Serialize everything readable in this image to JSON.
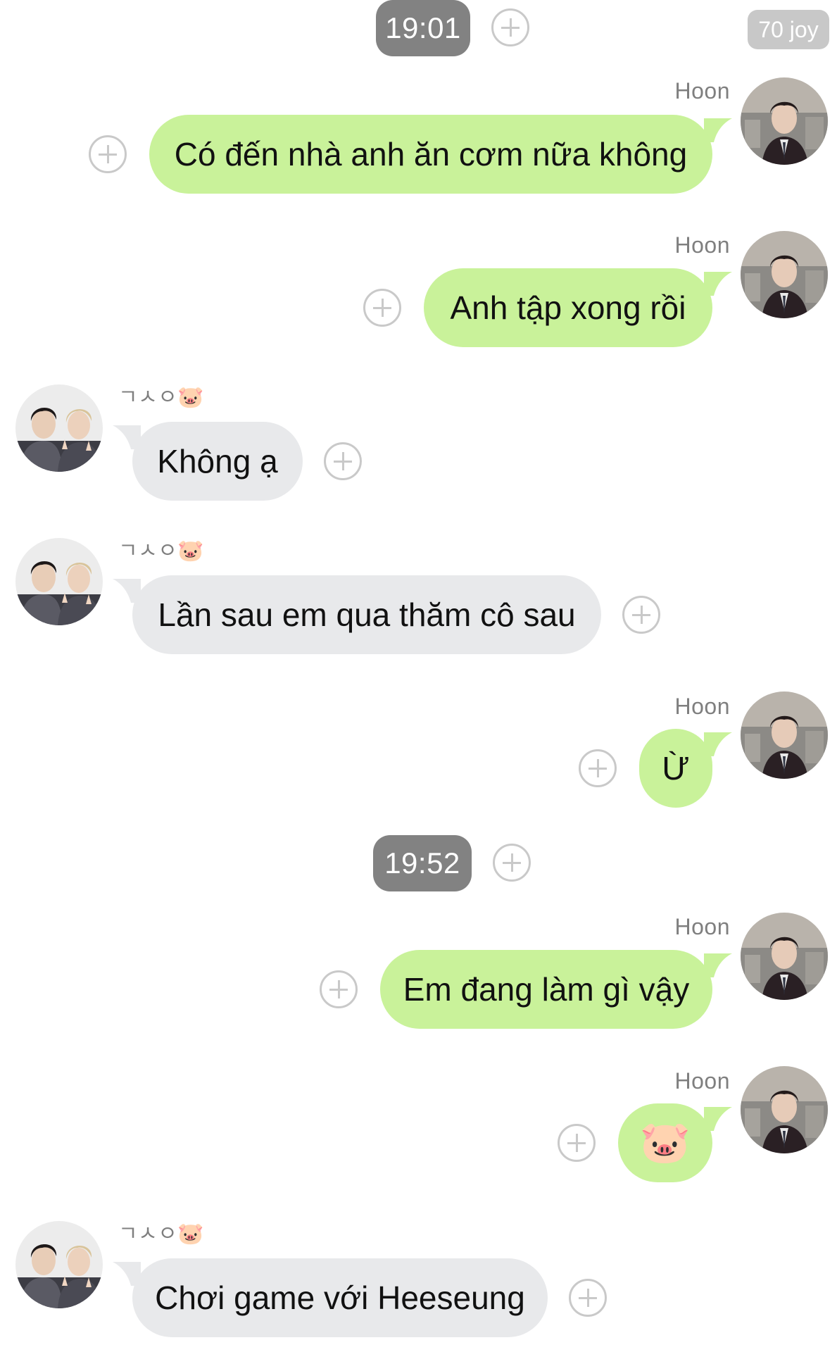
{
  "colors": {
    "outgoing_bubble": "#c9f29a",
    "incoming_bubble": "#e8e9eb",
    "time_pill": "#828282",
    "badge": "#c8c8c8",
    "sender_text": "#7f7f7f"
  },
  "badge": {
    "text": "70 joy"
  },
  "time_markers": [
    "19:01",
    "19:52"
  ],
  "contacts": {
    "me": {
      "name": "Hoon"
    },
    "other": {
      "name": "ㄱㅅㅇ🐷"
    }
  },
  "messages": [
    {
      "side": "out",
      "sender": "Hoon",
      "text": "Có đến nhà anh ăn cơm nữa không"
    },
    {
      "side": "out",
      "sender": "Hoon",
      "text": "Anh tập xong rồi"
    },
    {
      "side": "in",
      "sender": "ㄱㅅㅇ🐷",
      "text": "Không ạ"
    },
    {
      "side": "in",
      "sender": "ㄱㅅㅇ🐷",
      "text": "Lần sau em qua thăm cô sau"
    },
    {
      "side": "out",
      "sender": "Hoon",
      "text": "Ừ"
    },
    {
      "side": "out",
      "sender": "Hoon",
      "text": "Em đang làm gì vậy"
    },
    {
      "side": "out",
      "sender": "Hoon",
      "text": "🐷"
    },
    {
      "side": "in",
      "sender": "ㄱㅅㅇ🐷",
      "text": "Chơi game với Heeseung"
    }
  ]
}
